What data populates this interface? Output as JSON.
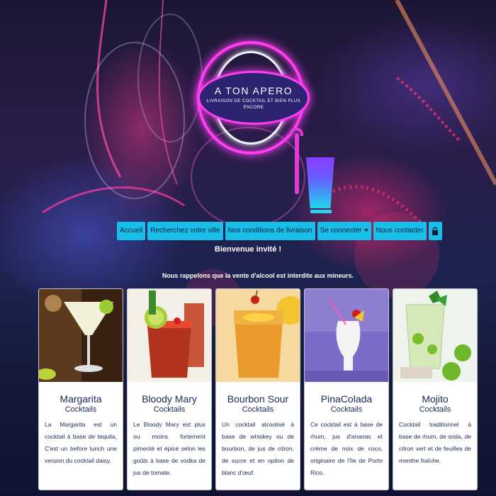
{
  "logo": {
    "title": "A TON APERO",
    "subtitle": "LIVRAISON DE COCKTAIL ET BIEN PLUS ENCORE"
  },
  "nav": {
    "items": [
      {
        "label": "Accueil"
      },
      {
        "label": "Recherchez votre ville"
      },
      {
        "label": "Nos conditions de livraison"
      },
      {
        "label": "Se connecter"
      },
      {
        "label": "Nous contacter"
      }
    ],
    "lock_icon": "lock-icon"
  },
  "welcome": "Bienvenue invité !",
  "notice": "Nous rappelons que la vente d'alcool est interdite aux mineurs.",
  "cards": [
    {
      "name": "Margarita",
      "category": "Cocktails",
      "description": "La Margarita est un cocktail à base de tequila, C'est un before lunch une version du cocktail daisy."
    },
    {
      "name": "Bloody Mary",
      "category": "Cocktails",
      "description": "Le Bloody Mary est plus ou moins fortement pimenté et épicé selon les goûts à base de vodka de jus de tomate."
    },
    {
      "name": "Bourbon Sour",
      "category": "Cocktails",
      "description": "Un cocktail alcoolisé à base de whiskey ou de bourbon, de jus de citron, de sucre et en option de blanc d'œuf."
    },
    {
      "name": "PinaColada",
      "category": "Cocktails",
      "description": "Ce cocktail est à base de rhum, jus d'ananas et crème de noix de coco, originaire de l'île de Porto Rico."
    },
    {
      "name": "Mojito",
      "category": "Cocktails",
      "description": "Cocktail traditionnel à base de rhum, de soda, de citron vert et de feuilles de menthe fraîche."
    }
  ],
  "colors": {
    "nav_button": "#17bfe8",
    "neon_pink": "#ff3df2",
    "logo_fill": "#2c2470",
    "card_text": "#1a2a5a"
  }
}
